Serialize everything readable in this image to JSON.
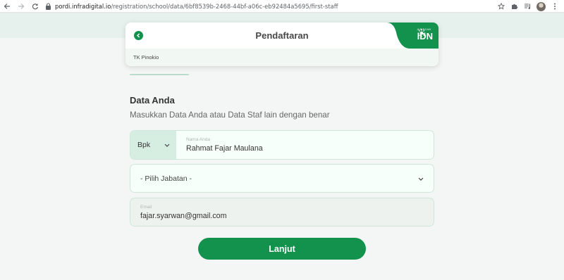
{
  "browser": {
    "url_host": "pordi.infradigital.io",
    "url_path": "/registration/school/data/6bf8539b-2468-44bf-a06c-eb92484a5695/first-staff",
    "icons": [
      "back-arrow-icon",
      "forward-arrow-icon",
      "reload-icon",
      "lock-icon",
      "star-icon",
      "extensions-icon",
      "media-icon",
      "profile-avatar",
      "kebab-menu-icon"
    ]
  },
  "header": {
    "title": "Pendaftaran",
    "school_name": "TK Pinokio",
    "brand_small": "JARINGAN",
    "brand_big": "IDN"
  },
  "form": {
    "section_title": "Data Anda",
    "section_description": "Masukkan Data Anda atau Data Staf lain dengan benar",
    "salutation_value": "Bpk",
    "name_label": "Nama Anda",
    "name_value": "Rahmat Fajar Maulana",
    "position_value": "- Pilih Jabatan -",
    "email_label": "Email",
    "email_value": "fajar.syarwan@gmail.com",
    "submit_label": "Lanjut"
  },
  "colors": {
    "primary": "#13924e",
    "band": "#e6f0ec",
    "field_bg": "#f7fffb",
    "field_border": "#cfe7da"
  }
}
